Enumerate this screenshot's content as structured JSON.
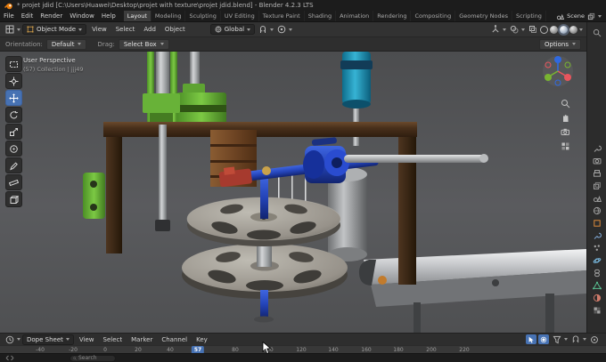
{
  "titlebar": {
    "title": "* projet jdid [C:\\Users\\Huawei\\Desktop\\projet with texture\\projet jdid.blend] - Blender 4.2.3 LTS"
  },
  "menubar": {
    "menus": [
      "File",
      "Edit",
      "Render",
      "Window",
      "Help"
    ],
    "workspaces": [
      "Layout",
      "Modeling",
      "Sculpting",
      "UV Editing",
      "Texture Paint",
      "Shading",
      "Animation",
      "Rendering",
      "Compositing",
      "Geometry Nodes",
      "Scripting"
    ],
    "scene_label": "Scene"
  },
  "viewport_header": {
    "mode": "Object Mode",
    "menus": [
      "View",
      "Select",
      "Add",
      "Object"
    ],
    "orientation": "Global"
  },
  "tool_settings": {
    "orientation_label": "Orientation:",
    "orientation_value": "Default",
    "drag_label": "Drag:",
    "drag_value": "Select Box",
    "options_label": "Options"
  },
  "viewport": {
    "overlay_line1": "User Perspective",
    "overlay_line2": "(57) Collection | jjj49"
  },
  "timeline": {
    "editor_label": "Dope Sheet",
    "menus": [
      "View",
      "Select",
      "Marker",
      "Channel",
      "Key"
    ],
    "current_frame": "57",
    "ticks": [
      "-40",
      "-20",
      "0",
      "20",
      "40",
      "80",
      "100",
      "120",
      "140",
      "160",
      "180",
      "200",
      "220"
    ]
  },
  "statusbar": {
    "search_placeholder": "Search"
  },
  "colors": {
    "accent": "#4772b3",
    "header_bg": "#323232",
    "dark_bg": "#1c1c1c"
  }
}
